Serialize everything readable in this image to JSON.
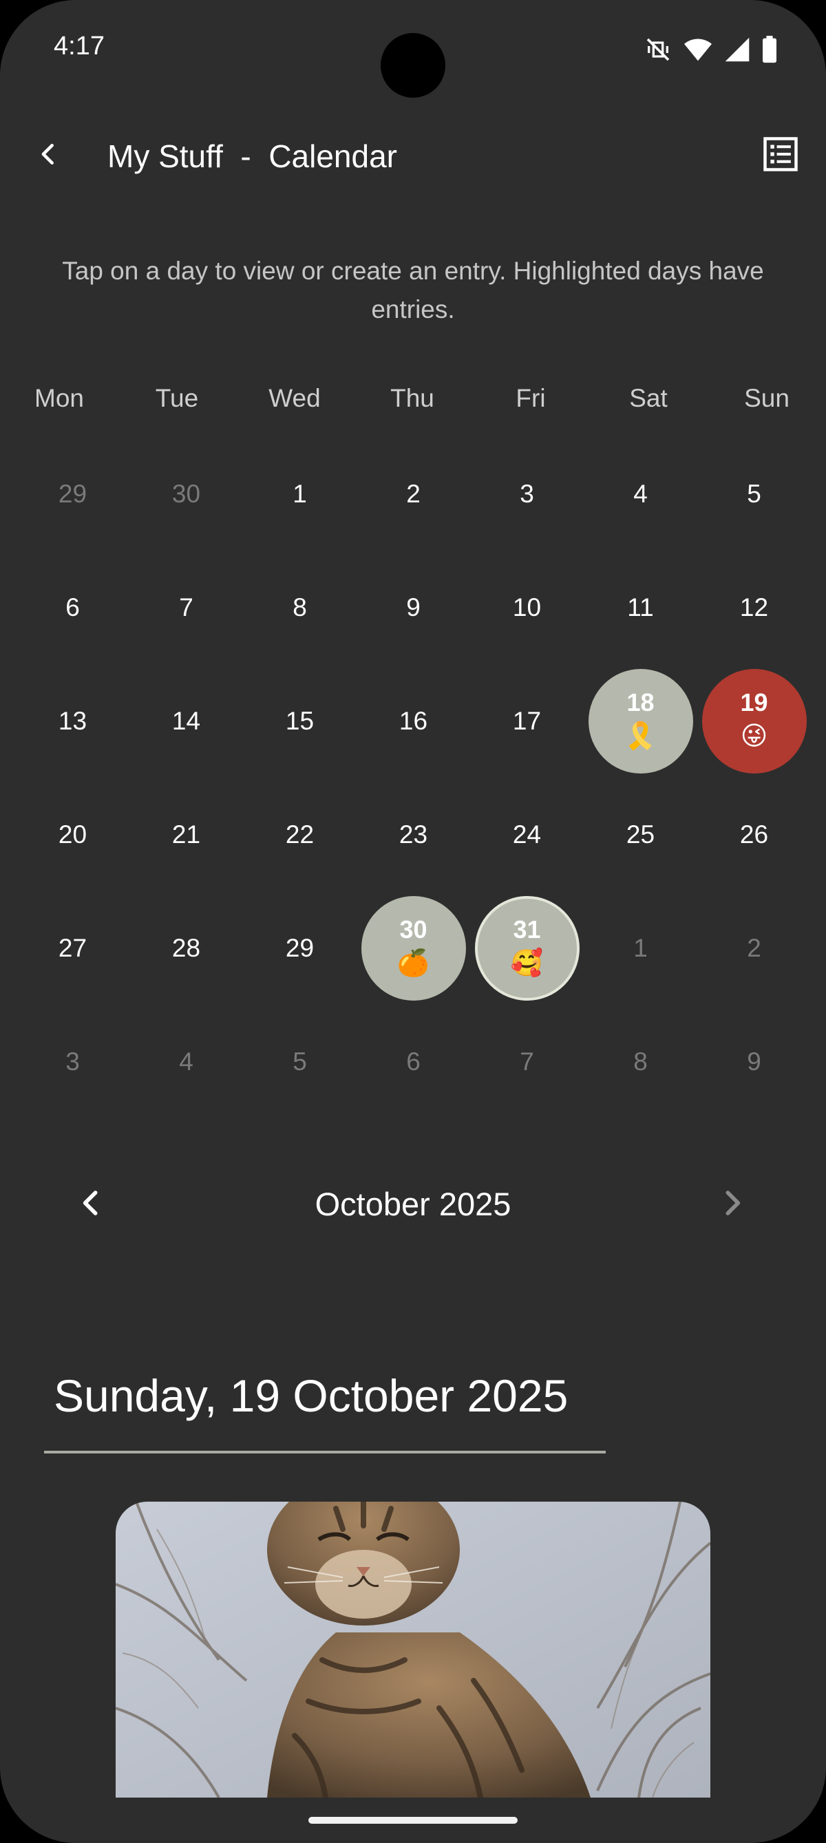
{
  "status_bar": {
    "time": "4:17",
    "icons": [
      "vibrate-off-icon",
      "wifi-icon",
      "signal-icon",
      "battery-icon"
    ]
  },
  "app_bar": {
    "title": "My Stuff  -  Calendar",
    "back_icon": "back-arrow-icon",
    "list_icon": "list-view-icon"
  },
  "instructions": "Tap on a day to view or create an entry. Highlighted days have entries.",
  "weekdays": [
    "Mon",
    "Tue",
    "Wed",
    "Thu",
    "Fri",
    "Sat",
    "Sun"
  ],
  "calendar": {
    "weeks": [
      [
        {
          "day": "29",
          "muted": true
        },
        {
          "day": "30",
          "muted": true
        },
        {
          "day": "1"
        },
        {
          "day": "2"
        },
        {
          "day": "3"
        },
        {
          "day": "4"
        },
        {
          "day": "5"
        }
      ],
      [
        {
          "day": "6"
        },
        {
          "day": "7"
        },
        {
          "day": "8"
        },
        {
          "day": "9"
        },
        {
          "day": "10"
        },
        {
          "day": "11"
        },
        {
          "day": "12"
        }
      ],
      [
        {
          "day": "13"
        },
        {
          "day": "14"
        },
        {
          "day": "15"
        },
        {
          "day": "16"
        },
        {
          "day": "17"
        },
        {
          "day": "18",
          "emoji": "🎗️",
          "entry": true
        },
        {
          "day": "19",
          "emoji": "😜",
          "entry": true,
          "selected": true
        }
      ],
      [
        {
          "day": "20"
        },
        {
          "day": "21"
        },
        {
          "day": "22"
        },
        {
          "day": "23"
        },
        {
          "day": "24"
        },
        {
          "day": "25"
        },
        {
          "day": "26"
        }
      ],
      [
        {
          "day": "27"
        },
        {
          "day": "28"
        },
        {
          "day": "29"
        },
        {
          "day": "30",
          "emoji": "🍊",
          "entry": true
        },
        {
          "day": "31",
          "emoji": "🥰",
          "entry": true,
          "today": true
        },
        {
          "day": "1",
          "muted": true
        },
        {
          "day": "2",
          "muted": true
        }
      ],
      [
        {
          "day": "3",
          "muted": true
        },
        {
          "day": "4",
          "muted": true
        },
        {
          "day": "5",
          "muted": true
        },
        {
          "day": "6",
          "muted": true
        },
        {
          "day": "7",
          "muted": true
        },
        {
          "day": "8",
          "muted": true
        },
        {
          "day": "9",
          "muted": true
        }
      ]
    ],
    "entry_color": "#b5b8ac",
    "selected_color": "#b03a30"
  },
  "month_nav": {
    "label": "October 2025",
    "prev_icon": "chevron-left-icon",
    "next_icon": "chevron-right-icon"
  },
  "selected_date": "Sunday, 19 October 2025",
  "entry_photo": {
    "subject": "tabby cat photo"
  }
}
